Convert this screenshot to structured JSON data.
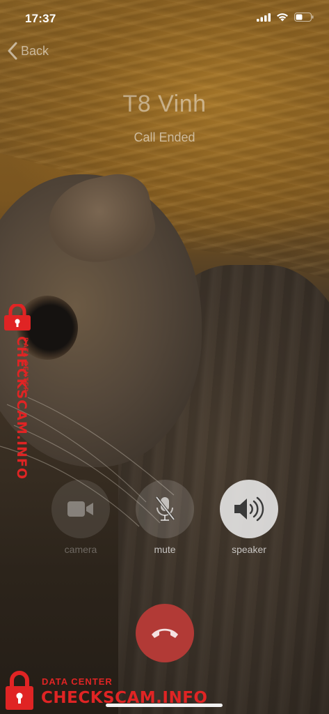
{
  "status_bar": {
    "time": "17:37",
    "signal_icon": "cellular-signal-icon",
    "wifi_icon": "wifi-icon",
    "battery_icon": "battery-icon"
  },
  "nav": {
    "back_label": "Back",
    "back_icon": "chevron-left-icon"
  },
  "call": {
    "contact_name": "T8 Vinh",
    "status": "Call Ended"
  },
  "controls": {
    "camera_label": "camera",
    "mute_label": "mute",
    "speaker_label": "speaker",
    "camera_icon": "video-camera-icon",
    "mute_icon": "microphone-muted-icon",
    "speaker_icon": "speaker-icon",
    "end_call_icon": "phone-hangup-icon"
  },
  "watermark": {
    "top_text": "DATA CENTER",
    "main_text": "CHECKSCAM.INFO",
    "icon": "padlock-icon"
  },
  "colors": {
    "end_call": "#b23a36",
    "watermark": "#e02424"
  }
}
